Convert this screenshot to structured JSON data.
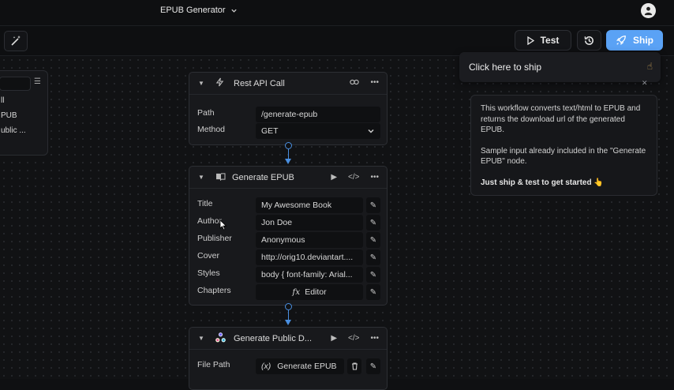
{
  "header": {
    "app_title": "EPUB Generator"
  },
  "toolbar": {
    "test_label": "Test",
    "ship_label": "Ship"
  },
  "tooltip": {
    "text": "Click here to ship"
  },
  "left_panel": {
    "items": [
      "ll",
      "PUB",
      "ublic ..."
    ]
  },
  "info_panel": {
    "para1": "This workflow converts text/html to EPUB and returns the download url of the generated EPUB.",
    "para2": "Sample input already included in the \"Generate EPUB\" node.",
    "para3": "Just ship & test to get started 👆"
  },
  "nodes": {
    "rest_api": {
      "title": "Rest API Call",
      "fields": [
        {
          "label": "Path",
          "value": "/generate-epub"
        },
        {
          "label": "Method",
          "value": "GET"
        }
      ]
    },
    "generate_epub": {
      "title": "Generate EPUB",
      "fields": [
        {
          "label": "Title",
          "value": "My Awesome Book"
        },
        {
          "label": "Author",
          "value": "Jon Doe"
        },
        {
          "label": "Publisher",
          "value": "Anonymous"
        },
        {
          "label": "Cover",
          "value": "http://orig10.deviantart...."
        },
        {
          "label": "Styles",
          "value": "body { font-family: Arial..."
        },
        {
          "label": "Chapters",
          "value": "Editor"
        }
      ]
    },
    "generate_public": {
      "title": "Generate Public D...",
      "fields": [
        {
          "label": "File Path",
          "value": "Generate EPUB"
        }
      ]
    }
  },
  "colors": {
    "accent": "#5aa2f5",
    "connector": "#4a8fe0",
    "background": "#111214"
  }
}
